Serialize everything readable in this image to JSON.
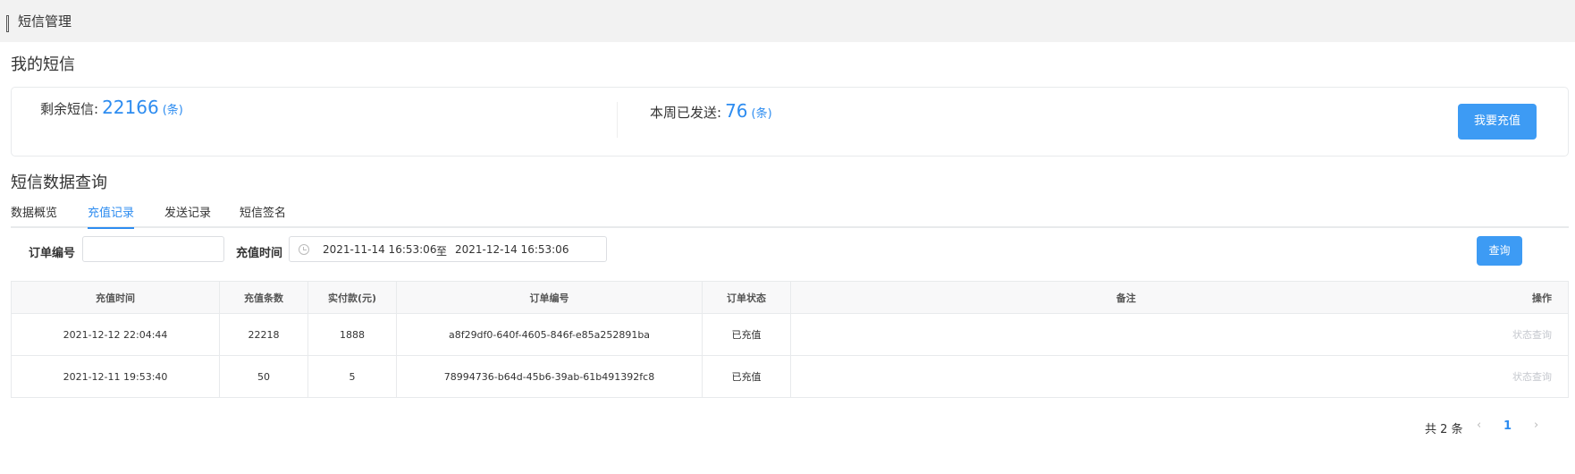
{
  "header": {
    "title": "短信管理"
  },
  "my_sms": {
    "title": "我的短信",
    "remaining_label": "剩余短信:",
    "remaining_value": "22166",
    "remaining_unit": "(条)",
    "sent_label": "本周已发送:",
    "sent_value": "76",
    "sent_unit": "(条)",
    "recharge_button": "我要充值"
  },
  "query": {
    "title": "短信数据查询",
    "tabs": [
      {
        "label": "数据概览",
        "active": false
      },
      {
        "label": "充值记录",
        "active": true
      },
      {
        "label": "发送记录",
        "active": false
      },
      {
        "label": "短信签名",
        "active": false
      }
    ],
    "filters": {
      "order_label": "订单编号",
      "order_value": "",
      "time_label": "充值时间",
      "start_date": "2021-11-14 16:53:06",
      "separator": "至",
      "end_date": "2021-12-14 16:53:06",
      "query_button": "查询"
    }
  },
  "table": {
    "columns": [
      "充值时间",
      "充值条数",
      "实付款(元)",
      "订单编号",
      "订单状态",
      "备注",
      "操作"
    ],
    "rows": [
      {
        "time": "2021-12-12 22:04:44",
        "count": "22218",
        "paid": "1888",
        "order": "a8f29df0-640f-4605-846f-e85a252891ba",
        "status": "已充值",
        "note": "",
        "action": "状态查询"
      },
      {
        "time": "2021-12-11 19:53:40",
        "count": "50",
        "paid": "5",
        "order": "78994736-b64d-45b6-39ab-61b491392fc8",
        "status": "已充值",
        "note": "",
        "action": "状态查询"
      }
    ]
  },
  "pagination": {
    "total_text": "共 2 条",
    "current_page": "1"
  },
  "colors": {
    "accent": "#2d8cf0",
    "button": "#3d9bf4",
    "header_bg": "#f2f2f2"
  }
}
